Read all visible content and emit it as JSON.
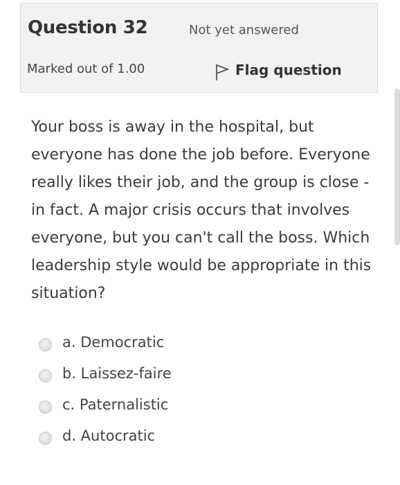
{
  "info": {
    "title": "Question 32",
    "state": "Not yet answered",
    "grade": "Marked out of 1.00",
    "flag_label": "Flag question",
    "flag_icon": "flag-outline-icon"
  },
  "question": {
    "text": "Your boss is away in the hospital, but everyone has done the job before. Everyone really likes their job, and the group is close - in fact. A major crisis occurs that involves everyone, but you can't call the boss. Which leadership style would be appropriate in this situation?"
  },
  "answers": [
    {
      "label": "a. Democratic"
    },
    {
      "label": "b. Laissez-faire"
    },
    {
      "label": "c. Paternalistic"
    },
    {
      "label": "d. Autocratic"
    }
  ]
}
